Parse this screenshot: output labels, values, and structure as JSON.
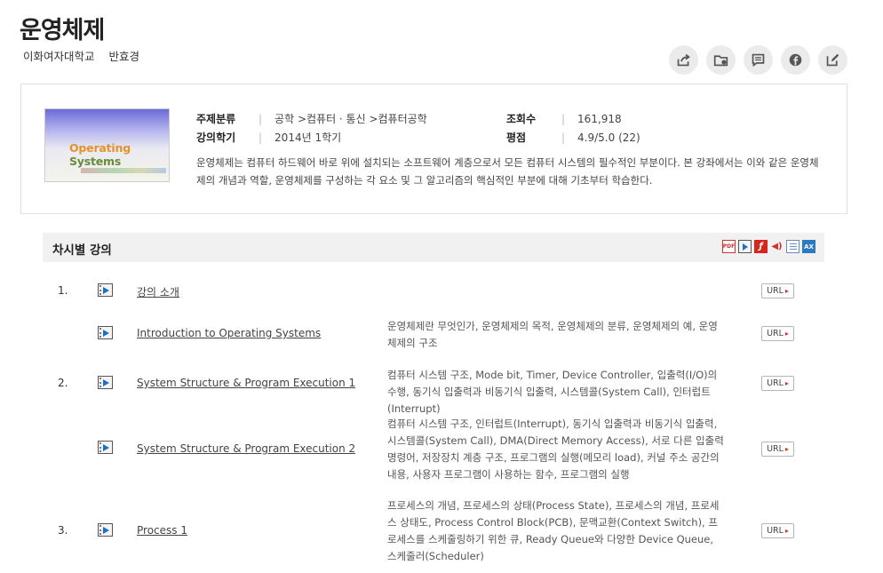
{
  "course": {
    "title": "운영체제",
    "university": "이화여자대학교",
    "professor": "반효경"
  },
  "actions": [
    {
      "name": "share-icon"
    },
    {
      "name": "folder-add-icon"
    },
    {
      "name": "comment-icon"
    },
    {
      "name": "facebook-icon"
    },
    {
      "name": "edit-icon"
    }
  ],
  "thumbnail": {
    "title_part1": "Operating",
    "title_part2": "Systems"
  },
  "meta": {
    "category_label": "주제분류",
    "category_value": "공학 >컴퓨터 · 통신 >컴퓨터공학",
    "views_label": "조회수",
    "views_value": "161,918",
    "semester_label": "강의학기",
    "semester_value": "2014년 1학기",
    "rating_label": "평점",
    "rating_value": "4.9/5.0 (22)"
  },
  "description": "운영체제는 컴퓨터 하드웨어 바로 위에 설치되는 소프트웨어 계층으로서 모든 컴퓨터 시스템의 필수적인 부분이다. 본 강좌에서는 이와 같은 운영체제의 개념과 역할, 운영체제를 구성하는 각 요소 및 그 알고리즘의 핵심적인 부분에 대해 기초부터 학습한다.",
  "section": {
    "title": "차시별 강의",
    "format_icons": [
      "pdf-icon",
      "video-icon",
      "flash-icon",
      "audio-icon",
      "document-icon",
      "ax-icon"
    ],
    "ax_label": "AX",
    "pdf_label": "PDF"
  },
  "lectures": [
    {
      "num": "1.",
      "title": "강의 소개",
      "desc": "",
      "url_label": "URL"
    },
    {
      "num": "",
      "title": "Introduction to Operating Systems",
      "desc": "운영체제란 무엇인가, 운영체제의 목적, 운영체제의 분류, 운영체제의 예, 운영체제의 구조",
      "url_label": "URL"
    },
    {
      "num": "2.",
      "title": "System Structure & Program Execution 1",
      "desc": "컴퓨터 시스템 구조, Mode bit, Timer, Device Controller, 입출력(I/O)의 수행, 동기식 입출력과 비동기식 입출력, 시스템콜(System Call), 인터럽트(Interrupt)",
      "url_label": "URL"
    },
    {
      "num": "",
      "title": "System Structure & Program Execution 2",
      "desc": "컴퓨터 시스템 구조, 인터럽트(Interrupt), 동기식 입출력과 비동기식 입출력, 시스템콜(System Call), DMA(Direct Memory Access), 서로 다른 입출력 명령어, 저장장치 계층 구조, 프로그램의 실행(메모리 load), 커널 주소 공간의 내용, 사용자 프로그램이 사용하는 함수, 프로그램의 실행",
      "url_label": "URL"
    },
    {
      "num": "3.",
      "title": "Process 1",
      "desc": "프로세스의 개념, 프로세스의 상태(Process State), 프로세스의 개념, 프로세스 상태도, Process Control Block(PCB), 문맥교환(Context Switch), 프로세스를 스케줄링하기 위한 큐, Ready Queue와 다양한 Device Queue, 스케줄러(Scheduler)",
      "url_label": "URL"
    }
  ]
}
